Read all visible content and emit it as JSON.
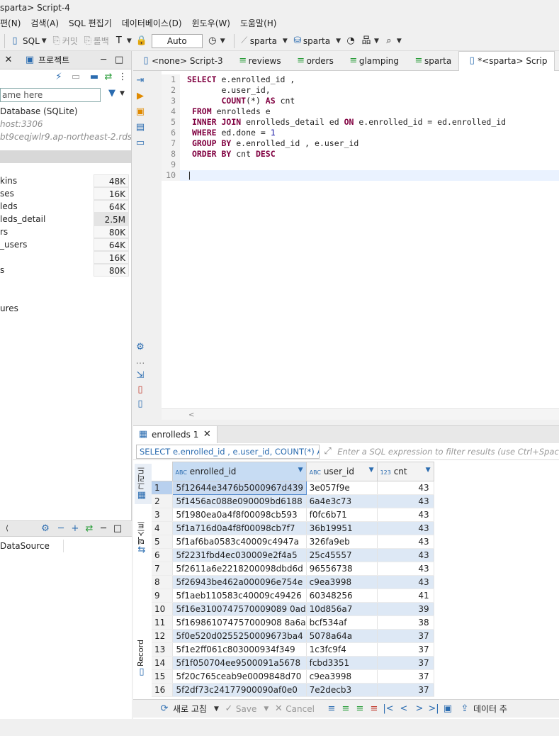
{
  "window_title": "sparta> Script-4",
  "menu": [
    "편(N)",
    "검색(A)",
    "SQL 편집기",
    "데이터베이스(D)",
    "윈도우(W)",
    "도움말(H)"
  ],
  "toolbar": {
    "sql": "SQL",
    "commit": "커밋",
    "rollback": "롤백",
    "auto": "Auto",
    "schema1": "sparta",
    "schema2": "sparta"
  },
  "left_panel": {
    "tab": "프로젝트",
    "filter_placeholder": "ame here",
    "tree": [
      {
        "text": "Database (SQLite)",
        "muted": false
      },
      {
        "text": "host:3306",
        "muted": true
      },
      {
        "text": "bt9ceqjwlr9.ap-northeast-2.rds.am",
        "muted": true
      }
    ],
    "tables": [
      {
        "name": "kins",
        "size": "48K"
      },
      {
        "name": "ses",
        "size": "16K"
      },
      {
        "name": "leds",
        "size": "64K"
      },
      {
        "name": "leds_detail",
        "size": "2.5M"
      },
      {
        "name": "rs",
        "size": "80K"
      },
      {
        "name": "_users",
        "size": "64K"
      },
      {
        "name": "",
        "size": "16K"
      },
      {
        "name": "s",
        "size": "80K"
      }
    ],
    "after_tables": "ures",
    "lower_label": "DataSource"
  },
  "editor_tabs": [
    {
      "label": "<none> Script-3",
      "active": false
    },
    {
      "label": "reviews",
      "active": false
    },
    {
      "label": "orders",
      "active": false
    },
    {
      "label": "glamping",
      "active": false
    },
    {
      "label": "sparta",
      "active": false
    },
    {
      "label": "*<sparta> Scrip",
      "active": true
    }
  ],
  "sql_lines": [
    "SELECT e.enrolled_id ,",
    "       e.user_id,",
    "       COUNT(*) AS cnt",
    " FROM enrolleds e",
    " INNER JOIN enrolleds_detail ed ON e.enrolled_id = ed.enrolled_id",
    " WHERE ed.done = 1",
    " GROUP BY e.enrolled_id , e.user_id",
    " ORDER BY cnt DESC",
    "",
    ""
  ],
  "results": {
    "tab": "enrolleds 1",
    "filter_sql": "SELECT e.enrolled_id , e.user_id, COUNT(*) AS",
    "filter_placeholder": "Enter a SQL expression to filter results (use Ctrl+Space)",
    "side_grid": "그리드",
    "side_text": "텍스트",
    "side_record": "Record",
    "columns": [
      {
        "type": "ABC",
        "name": "enrolled_id"
      },
      {
        "type": "ABC",
        "name": "user_id"
      },
      {
        "type": "123",
        "name": "cnt"
      }
    ],
    "rows": [
      [
        "1",
        "5f12644e3476b5000967d439",
        "3e057f9e",
        "43"
      ],
      [
        "2",
        "5f1456ac088e090009bd6188",
        "6a4e3c73",
        "43"
      ],
      [
        "3",
        "5f1980ea0a4f8f00098cb593",
        "f0fc6b71",
        "43"
      ],
      [
        "4",
        "5f1a716d0a4f8f00098cb7f7",
        "36b19951",
        "43"
      ],
      [
        "5",
        "5f1af6ba0583c40009c4947a",
        "326fa9eb",
        "43"
      ],
      [
        "6",
        "5f2231fbd4ec030009e2f4a5",
        "25c45557",
        "43"
      ],
      [
        "7",
        "5f2611a6e2218200098dbd6d",
        "96556738",
        "43"
      ],
      [
        "8",
        "5f26943be462a000096e754e",
        "c9ea3998",
        "43"
      ],
      [
        "9",
        "5f1aeb110583c40009c49426",
        "60348256",
        "41"
      ],
      [
        "10",
        "5f16e3100747570009089 0ad",
        "10d856a7",
        "39"
      ],
      [
        "11",
        "5f169861074757000908 8a6a",
        "bcf534af",
        "38"
      ],
      [
        "12",
        "5f0e520d0255250009673ba4",
        "5078a64a",
        "37"
      ],
      [
        "13",
        "5f1e2ff061c803000934f349",
        "1c3fc9f4",
        "37"
      ],
      [
        "14",
        "5f1f050704ee9500091a5678",
        "fcbd3351",
        "37"
      ],
      [
        "15",
        "5f20c765ceab9e0009848d70",
        "c9ea3998",
        "37"
      ],
      [
        "16",
        "5f2df73c24177900090af0e0",
        "7e2decb3",
        "37"
      ]
    ],
    "bottom": {
      "refresh": "새로 고침",
      "save": "Save",
      "cancel": "Cancel",
      "export": "데이터 추"
    }
  }
}
